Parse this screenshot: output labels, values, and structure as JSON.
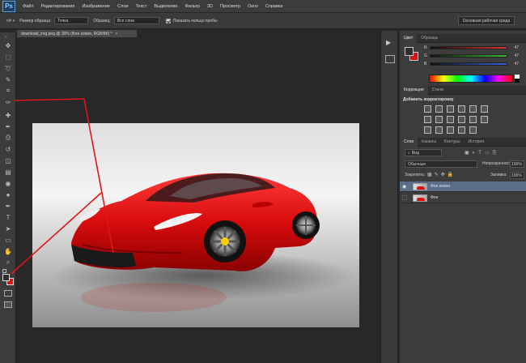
{
  "app": {
    "logo": "Ps",
    "menu": [
      "Файл",
      "Редактирование",
      "Изображение",
      "Слои",
      "Текст",
      "Выделение",
      "Фильтр",
      "3D",
      "Просмотр",
      "Окно",
      "Справка"
    ]
  },
  "options_bar": {
    "tool_icon": "eyedropper-icon",
    "sample_size_label": "Размер образца:",
    "sample_size_value": "Точка",
    "sample_label": "Образец:",
    "sample_value": "Все слои",
    "show_ring_label": "Показать кольцо пробы",
    "workspace_button": "Основная рабочая среда"
  },
  "document": {
    "tab_title": "download_img.png @ 30% (Фон копия, RGB/8#) *",
    "close_glyph": "×"
  },
  "tools": [
    "move-icon",
    "marquee-icon",
    "lasso-icon",
    "quick-select-icon",
    "crop-icon",
    "eyedropper-icon",
    "healing-brush-icon",
    "brush-icon",
    "clone-stamp-icon",
    "history-brush-icon",
    "eraser-icon",
    "gradient-icon",
    "blur-icon",
    "dodge-icon",
    "pen-icon",
    "type-icon",
    "path-select-icon",
    "shape-icon",
    "hand-icon",
    "zoom-icon"
  ],
  "tool_glyphs": [
    "✥",
    "⬚",
    "➰",
    "✎",
    "⌗",
    "✑",
    "✚",
    "✒",
    "⎙",
    "↺",
    "◫",
    "▤",
    "◉",
    "●",
    "✒",
    "T",
    "➤",
    "▭",
    "✋",
    "⌕"
  ],
  "color_panel": {
    "tabs": [
      "Цвет",
      "Образцы"
    ],
    "channels": [
      {
        "letter": "R",
        "value": "47",
        "color": "#e03030"
      },
      {
        "letter": "G",
        "value": "47",
        "color": "#30c030"
      },
      {
        "letter": "B",
        "value": "47",
        "color": "#3060e0"
      }
    ],
    "foreground": "#2f2f2f",
    "background": "#e01010"
  },
  "adjustments_panel": {
    "tabs": [
      "Коррекция",
      "Стили"
    ],
    "title": "Добавить корректировку"
  },
  "layers_panel": {
    "tabs": [
      "Слои",
      "Каналы",
      "Контуры",
      "История"
    ],
    "kind_filter": "Вид",
    "blend_mode": "Обычные",
    "opacity_label": "Непрозрачность:",
    "opacity_value": "100%",
    "lock_label": "Закрепить:",
    "fill_label": "Заливка:",
    "fill_value": "100%",
    "layers": [
      {
        "name": "Фон копия",
        "selected": true,
        "visible": true
      },
      {
        "name": "Фон",
        "selected": false,
        "visible": false
      }
    ]
  },
  "accent_color": "#e01515"
}
